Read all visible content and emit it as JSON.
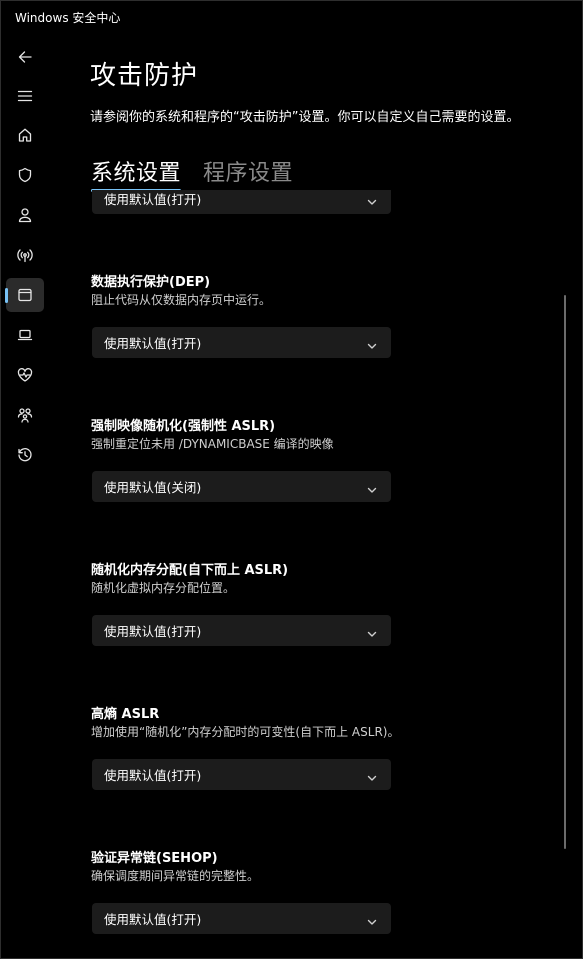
{
  "window": {
    "title": "Windows 安全中心"
  },
  "nav": {
    "items": [
      {
        "name": "back",
        "icon": "back-arrow-icon"
      },
      {
        "name": "menu",
        "icon": "hamburger-menu-icon"
      },
      {
        "name": "home",
        "icon": "home-icon"
      },
      {
        "name": "virus-protection",
        "icon": "shield-icon"
      },
      {
        "name": "account-protection",
        "icon": "person-icon"
      },
      {
        "name": "firewall-network",
        "icon": "wireless-antenna-icon"
      },
      {
        "name": "app-browser-control",
        "icon": "app-window-icon",
        "active": true
      },
      {
        "name": "device-security",
        "icon": "laptop-icon"
      },
      {
        "name": "device-performance",
        "icon": "heart-pulse-icon"
      },
      {
        "name": "family-options",
        "icon": "family-icon"
      },
      {
        "name": "protection-history",
        "icon": "history-icon"
      }
    ]
  },
  "page": {
    "title": "攻击防护",
    "description": "请参阅你的系统和程序的“攻击防护”设置。你可以自定义自己需要的设置。"
  },
  "tabs": [
    {
      "label": "系统设置",
      "selected": true
    },
    {
      "label": "程序设置",
      "selected": false
    }
  ],
  "settings": [
    {
      "name": "",
      "description": "",
      "value": "使用默认值(打开)"
    },
    {
      "name": "数据执行保护(DEP)",
      "description": "阻止代码从仅数据内存页中运行。",
      "value": "使用默认值(打开)"
    },
    {
      "name": "强制映像随机化(强制性 ASLR)",
      "description": "强制重定位未用 /DYNAMICBASE 编译的映像",
      "value": "使用默认值(关闭)"
    },
    {
      "name": "随机化内存分配(自下而上 ASLR)",
      "description": "随机化虚拟内存分配位置。",
      "value": "使用默认值(打开)"
    },
    {
      "name": "高熵 ASLR",
      "description": "增加使用“随机化”内存分配时的可变性(自下而上 ASLR)。",
      "value": "使用默认值(打开)"
    },
    {
      "name": "验证异常链(SEHOP)",
      "description": "确保调度期间异常链的完整性。",
      "value": "使用默认值(打开)"
    }
  ],
  "colors": {
    "background": "#000000",
    "accent": "#78c2f5",
    "dropdown_bg": "#1c1c1c",
    "muted_text": "#8a8a8a"
  }
}
